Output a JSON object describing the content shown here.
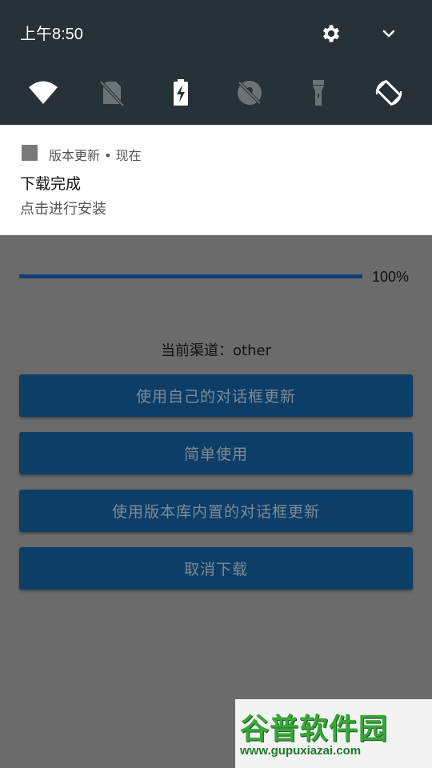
{
  "status_bar": {
    "time": "上午8:50"
  },
  "quick_settings": {
    "tiles": [
      {
        "icon": "wifi-icon"
      },
      {
        "icon": "no-sim-icon"
      },
      {
        "icon": "battery-charging-icon"
      },
      {
        "icon": "location-off-icon"
      },
      {
        "icon": "flashlight-icon"
      },
      {
        "icon": "auto-rotate-icon"
      }
    ]
  },
  "notification": {
    "app_name": "版本更新",
    "time": "现在",
    "title": "下载完成",
    "text": "点击进行安装"
  },
  "download": {
    "progress": 100,
    "progress_label": "100%"
  },
  "channel_label": "当前渠道：other",
  "buttons": {
    "own_dialog": "使用自己的对话框更新",
    "simple": "简单使用",
    "builtin_dialog": "使用版本库内置的对话框更新",
    "cancel_download": "取消下载"
  },
  "watermark": {
    "text": "谷普软件园",
    "url": "www.gupuxiazai.com"
  },
  "colors": {
    "shade_bg": "#263238",
    "button_bg": "#0d3e67",
    "progress": "#0d3e72"
  }
}
